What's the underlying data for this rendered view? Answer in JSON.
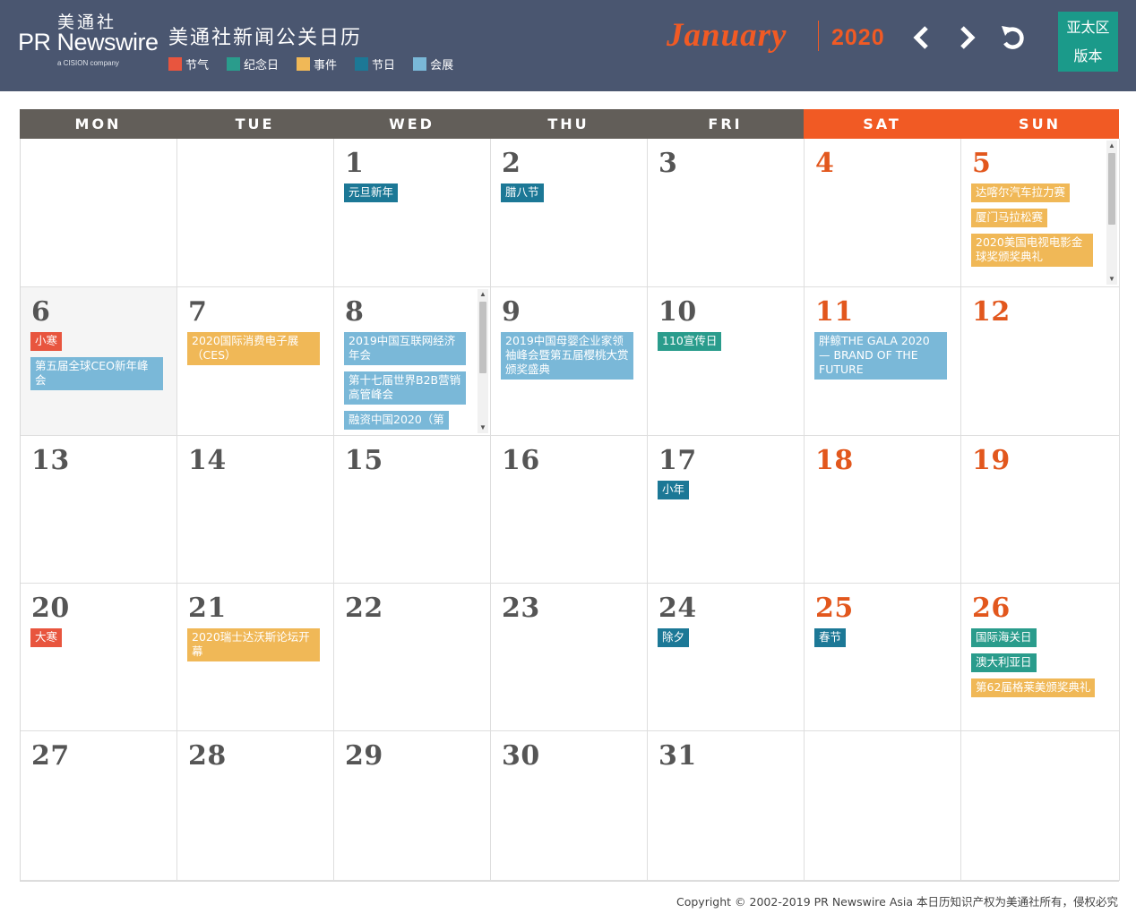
{
  "header": {
    "logo_cn": "美通社",
    "logo_en": "PR Newswire",
    "logo_sub": "a CISION company",
    "site_title": "美通社新闻公关日历",
    "month": "January",
    "year": "2020",
    "region_line1": "亚太区",
    "region_line2": "版本",
    "prev_icon": "chevron-left-icon",
    "next_icon": "chevron-right-icon",
    "reset_icon": "refresh-icon"
  },
  "legend": [
    {
      "label": "节气",
      "color": "#e8553e"
    },
    {
      "label": "纪念日",
      "color": "#2a9c8c"
    },
    {
      "label": "事件",
      "color": "#f0b857"
    },
    {
      "label": "节日",
      "color": "#1c7896"
    },
    {
      "label": "会展",
      "color": "#7ab8d8"
    }
  ],
  "weekdays": [
    "MON",
    "TUE",
    "WED",
    "THU",
    "FRI",
    "SAT",
    "SUN"
  ],
  "weeks": [
    [
      {
        "day": "",
        "events": []
      },
      {
        "day": "",
        "events": []
      },
      {
        "day": "1",
        "events": [
          {
            "text": "元旦新年",
            "type": "节日"
          }
        ]
      },
      {
        "day": "2",
        "events": [
          {
            "text": "腊八节",
            "type": "节日"
          }
        ]
      },
      {
        "day": "3",
        "events": []
      },
      {
        "day": "4",
        "events": []
      },
      {
        "day": "5",
        "events": [
          {
            "text": "达喀尔汽车拉力赛",
            "type": "事件"
          },
          {
            "text": "厦门马拉松赛",
            "type": "事件"
          },
          {
            "text": "2020美国电视电影金球奖颁奖典礼",
            "type": "事件"
          }
        ],
        "scroll": true
      }
    ],
    [
      {
        "day": "6",
        "today": true,
        "events": [
          {
            "text": "小寒",
            "type": "节气"
          },
          {
            "text": "第五届全球CEO新年峰会",
            "type": "会展"
          }
        ]
      },
      {
        "day": "7",
        "events": [
          {
            "text": "2020国际消费电子展（CES）",
            "type": "事件"
          }
        ]
      },
      {
        "day": "8",
        "events": [
          {
            "text": "2019中国互联网经济年会",
            "type": "会展"
          },
          {
            "text": "第十七届世界B2B营销高管峰会",
            "type": "会展"
          },
          {
            "text": "融资中国2020（第",
            "type": "会展"
          }
        ],
        "scroll": true
      },
      {
        "day": "9",
        "events": [
          {
            "text": "2019中国母婴企业家领袖峰会暨第五届樱桃大赏颁奖盛典",
            "type": "会展"
          }
        ]
      },
      {
        "day": "10",
        "events": [
          {
            "text": "110宣传日",
            "type": "纪念日"
          }
        ]
      },
      {
        "day": "11",
        "events": [
          {
            "text": "胖鲸THE GALA 2020 — BRAND OF THE FUTURE",
            "type": "会展"
          }
        ]
      },
      {
        "day": "12",
        "events": []
      }
    ],
    [
      {
        "day": "13",
        "events": []
      },
      {
        "day": "14",
        "events": []
      },
      {
        "day": "15",
        "events": []
      },
      {
        "day": "16",
        "events": []
      },
      {
        "day": "17",
        "events": [
          {
            "text": "小年",
            "type": "节日"
          }
        ]
      },
      {
        "day": "18",
        "events": []
      },
      {
        "day": "19",
        "events": []
      }
    ],
    [
      {
        "day": "20",
        "events": [
          {
            "text": "大寒",
            "type": "节气"
          }
        ]
      },
      {
        "day": "21",
        "events": [
          {
            "text": "2020瑞士达沃斯论坛开幕",
            "type": "事件"
          }
        ]
      },
      {
        "day": "22",
        "events": []
      },
      {
        "day": "23",
        "events": []
      },
      {
        "day": "24",
        "events": [
          {
            "text": "除夕",
            "type": "节日"
          }
        ]
      },
      {
        "day": "25",
        "events": [
          {
            "text": "春节",
            "type": "节日"
          }
        ]
      },
      {
        "day": "26",
        "events": [
          {
            "text": "国际海关日",
            "type": "纪念日"
          },
          {
            "text": "澳大利亚日",
            "type": "纪念日"
          },
          {
            "text": "第62届格莱美颁奖典礼",
            "type": "事件"
          }
        ]
      }
    ],
    [
      {
        "day": "27",
        "events": []
      },
      {
        "day": "28",
        "events": []
      },
      {
        "day": "29",
        "events": []
      },
      {
        "day": "30",
        "events": []
      },
      {
        "day": "31",
        "events": []
      },
      {
        "day": "",
        "events": []
      },
      {
        "day": "",
        "events": []
      }
    ]
  ],
  "footer": {
    "copyright": "Copyright © 2002-2019 PR Newswire Asia 本日历知识产权为美通社所有，侵权必究"
  }
}
